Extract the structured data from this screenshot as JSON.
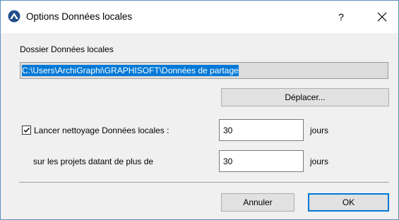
{
  "window": {
    "title": "Options Données locales",
    "help_label": "?",
    "app_icon": "archicad-logo-icon",
    "close_icon": "close-icon"
  },
  "folder": {
    "label": "Dossier Données locales",
    "path": "C:\\Users\\ArchiGraphi\\GRAPHISOFT\\Données de partage",
    "move_button": "Déplacer..."
  },
  "cleanup": {
    "checkbox_label": "Lancer nettoyage Données locales :",
    "checked": true,
    "days_value": "30",
    "days_unit": "jours",
    "projects_label": "sur les projets datant de plus de",
    "projects_value": "30",
    "projects_unit": "jours"
  },
  "footer": {
    "cancel_label": "Annuler",
    "ok_label": "OK"
  },
  "colors": {
    "accent": "#0078d7",
    "dialog_bg": "#f0f0f0"
  }
}
